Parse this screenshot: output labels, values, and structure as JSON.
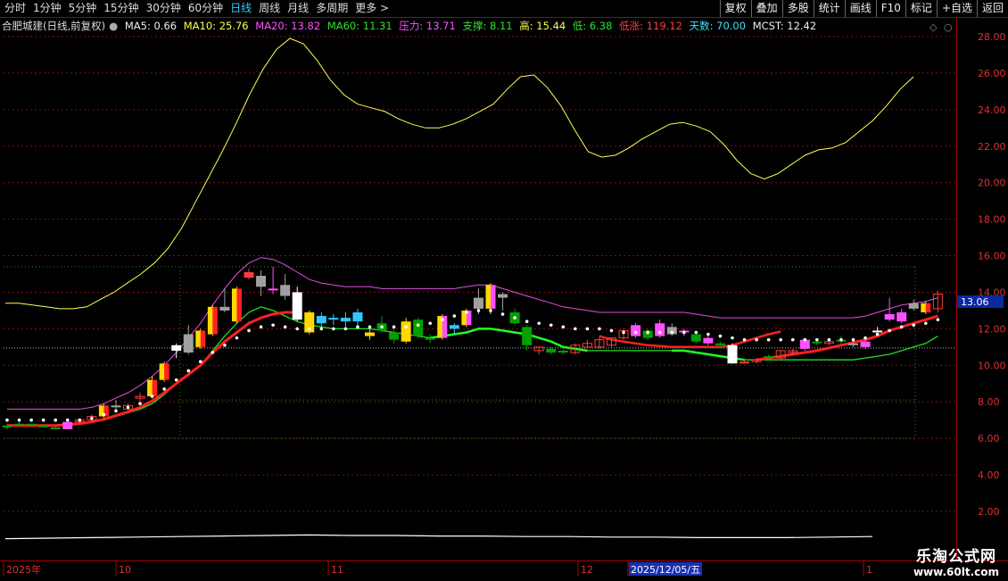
{
  "toolbar": {
    "periods": [
      "分时",
      "1分钟",
      "5分钟",
      "15分钟",
      "30分钟",
      "60分钟",
      "日线",
      "周线",
      "月线",
      "多周期",
      "更多 >"
    ],
    "active_period": "日线",
    "right_buttons": [
      "复权",
      "叠加",
      "多股",
      "统计",
      "画线",
      "F10",
      "标记",
      "+自选",
      "返回"
    ]
  },
  "info": {
    "stock": "合肥城建(日线,前复权)",
    "ma5": "MA5: 0.66",
    "ma10": "MA10: 25.76",
    "ma20": "MA20: 13.82",
    "ma60": "MA60: 11.31",
    "pressure": "压力: 13.71",
    "support": "支撑: 8.11",
    "high": "高: 15.44",
    "low": "低: 6.38",
    "lowrise": "低涨: 119.12",
    "days": "天数: 70.00",
    "mcst": "MCST: 12.42"
  },
  "colors": {
    "up": "#ff3c3c",
    "down": "#00a000",
    "yellow": "#ffff50",
    "magenta": "#ff50ff",
    "green": "#30e030",
    "cyan": "#40e0ff",
    "white": "#ffffff",
    "grid": "#801010"
  },
  "price_tag": "13.06",
  "dates": {
    "year": "2025年",
    "oct": "10",
    "nov": "11",
    "dec": "12",
    "cursor": "2025/12/05/五",
    "jan": "1"
  },
  "watermark": {
    "line1": "乐淘公式网",
    "line2": "www.60lt.com"
  },
  "chart_data": {
    "type": "candlestick",
    "ylim": [
      0.0,
      29.0
    ],
    "y_ticks": [
      2.0,
      4.0,
      6.0,
      8.0,
      10.0,
      12.0,
      14.0,
      16.0,
      18.0,
      20.0,
      22.0,
      24.0,
      26.0,
      28.0
    ],
    "horizontal_levels": {
      "pressure": 15.4,
      "support": 8.1,
      "mcst": 10.95
    },
    "candles": [
      {
        "o": 6.6,
        "h": 6.8,
        "l": 6.5,
        "c": 6.7,
        "t": "g"
      },
      {
        "o": 6.8,
        "h": 6.9,
        "l": 6.7,
        "c": 6.7,
        "t": "g"
      },
      {
        "o": 6.7,
        "h": 6.8,
        "l": 6.6,
        "c": 6.8,
        "t": "g"
      },
      {
        "o": 6.7,
        "h": 6.8,
        "l": 6.6,
        "c": 6.7,
        "t": "g"
      },
      {
        "o": 6.6,
        "h": 6.7,
        "l": 6.5,
        "c": 6.5,
        "t": "g"
      },
      {
        "o": 6.5,
        "h": 6.9,
        "l": 6.5,
        "c": 6.9,
        "t": "m"
      },
      {
        "o": 6.9,
        "h": 7.1,
        "l": 6.8,
        "c": 7.0,
        "t": "r"
      },
      {
        "o": 7.0,
        "h": 7.3,
        "l": 6.9,
        "c": 7.2,
        "t": "r"
      },
      {
        "o": 7.2,
        "h": 7.9,
        "l": 7.1,
        "c": 7.8,
        "t": "yr"
      },
      {
        "o": 7.8,
        "h": 8.1,
        "l": 7.5,
        "c": 7.7,
        "t": "gr"
      },
      {
        "o": 7.6,
        "h": 7.9,
        "l": 7.5,
        "c": 7.8,
        "t": "r"
      },
      {
        "o": 8.2,
        "h": 8.5,
        "l": 8.0,
        "c": 8.3,
        "t": "r"
      },
      {
        "o": 8.3,
        "h": 9.4,
        "l": 8.2,
        "c": 9.2,
        "t": "yr"
      },
      {
        "o": 9.2,
        "h": 10.2,
        "l": 9.1,
        "c": 10.1,
        "t": "yr"
      },
      {
        "o": 10.8,
        "h": 11.2,
        "l": 10.4,
        "c": 11.1,
        "t": "w"
      },
      {
        "o": 10.7,
        "h": 12.2,
        "l": 10.6,
        "c": 11.7,
        "t": "gr"
      },
      {
        "o": 11.0,
        "h": 12.0,
        "l": 10.9,
        "c": 11.9,
        "t": "yr"
      },
      {
        "o": 11.7,
        "h": 13.3,
        "l": 11.6,
        "c": 13.2,
        "t": "yr"
      },
      {
        "o": 13.0,
        "h": 14.2,
        "l": 12.9,
        "c": 13.2,
        "t": "gr"
      },
      {
        "o": 12.4,
        "h": 14.3,
        "l": 12.3,
        "c": 14.2,
        "t": "yr"
      },
      {
        "o": 15.1,
        "h": 15.3,
        "l": 14.7,
        "c": 14.8,
        "t": "r"
      },
      {
        "o": 14.9,
        "h": 15.2,
        "l": 13.8,
        "c": 14.3,
        "t": "gr"
      },
      {
        "o": 14.2,
        "h": 15.4,
        "l": 13.9,
        "c": 14.2,
        "t": "m"
      },
      {
        "o": 14.4,
        "h": 15.0,
        "l": 13.6,
        "c": 13.8,
        "t": "gr"
      },
      {
        "o": 14.0,
        "h": 14.3,
        "l": 12.4,
        "c": 12.5,
        "t": "w"
      },
      {
        "o": 12.9,
        "h": 13.0,
        "l": 11.7,
        "c": 11.8,
        "t": "y"
      },
      {
        "o": 12.7,
        "h": 12.9,
        "l": 12.1,
        "c": 12.3,
        "t": "c"
      },
      {
        "o": 12.6,
        "h": 12.8,
        "l": 12.2,
        "c": 12.5,
        "t": "c"
      },
      {
        "o": 12.6,
        "h": 12.9,
        "l": 12.1,
        "c": 12.4,
        "t": "c"
      },
      {
        "o": 12.4,
        "h": 13.1,
        "l": 12.2,
        "c": 12.9,
        "t": "c"
      },
      {
        "o": 11.8,
        "h": 12.0,
        "l": 11.4,
        "c": 11.6,
        "t": "y"
      },
      {
        "o": 12.3,
        "h": 12.7,
        "l": 11.8,
        "c": 11.9,
        "t": "g"
      },
      {
        "o": 11.8,
        "h": 12.0,
        "l": 11.2,
        "c": 11.4,
        "t": "g"
      },
      {
        "o": 12.4,
        "h": 12.6,
        "l": 11.2,
        "c": 11.3,
        "t": "y"
      },
      {
        "o": 12.5,
        "h": 12.6,
        "l": 11.5,
        "c": 11.6,
        "t": "g"
      },
      {
        "o": 11.5,
        "h": 11.7,
        "l": 11.2,
        "c": 11.4,
        "t": "g"
      },
      {
        "o": 11.5,
        "h": 12.8,
        "l": 11.4,
        "c": 12.7,
        "t": "ym"
      },
      {
        "o": 12.0,
        "h": 12.3,
        "l": 11.7,
        "c": 12.2,
        "t": "c"
      },
      {
        "o": 12.2,
        "h": 13.1,
        "l": 12.1,
        "c": 13.0,
        "t": "ym"
      },
      {
        "o": 13.1,
        "h": 14.2,
        "l": 12.8,
        "c": 13.7,
        "t": "gr"
      },
      {
        "o": 13.1,
        "h": 14.5,
        "l": 12.8,
        "c": 14.4,
        "t": "ym"
      },
      {
        "o": 13.9,
        "h": 14.0,
        "l": 13.0,
        "c": 13.7,
        "t": "gr"
      },
      {
        "o": 12.9,
        "h": 13.1,
        "l": 12.2,
        "c": 12.3,
        "t": "g"
      },
      {
        "o": 12.1,
        "h": 12.2,
        "l": 10.8,
        "c": 11.1,
        "t": "g"
      },
      {
        "o": 10.8,
        "h": 11.0,
        "l": 10.6,
        "c": 11.0,
        "t": "r"
      },
      {
        "o": 10.9,
        "h": 11.0,
        "l": 10.6,
        "c": 10.7,
        "t": "g"
      },
      {
        "o": 10.8,
        "h": 10.9,
        "l": 10.6,
        "c": 10.7,
        "t": "g"
      },
      {
        "o": 10.7,
        "h": 11.2,
        "l": 10.6,
        "c": 11.1,
        "t": "r"
      },
      {
        "o": 11.0,
        "h": 11.4,
        "l": 10.9,
        "c": 11.2,
        "t": "r"
      },
      {
        "o": 11.0,
        "h": 11.6,
        "l": 10.9,
        "c": 11.4,
        "t": "r"
      },
      {
        "o": 11.1,
        "h": 11.5,
        "l": 11.0,
        "c": 11.5,
        "t": "r"
      },
      {
        "o": 11.5,
        "h": 12.0,
        "l": 11.4,
        "c": 11.9,
        "t": "r"
      },
      {
        "o": 11.6,
        "h": 12.3,
        "l": 11.5,
        "c": 12.2,
        "t": "m"
      },
      {
        "o": 11.9,
        "h": 12.0,
        "l": 11.4,
        "c": 11.5,
        "t": "g"
      },
      {
        "o": 11.6,
        "h": 12.5,
        "l": 11.5,
        "c": 12.3,
        "t": "m"
      },
      {
        "o": 12.1,
        "h": 12.3,
        "l": 11.6,
        "c": 11.7,
        "t": "gr"
      },
      {
        "o": 11.8,
        "h": 12.0,
        "l": 11.6,
        "c": 11.9,
        "t": "m"
      },
      {
        "o": 11.7,
        "h": 11.8,
        "l": 11.2,
        "c": 11.3,
        "t": "g"
      },
      {
        "o": 11.2,
        "h": 11.6,
        "l": 11.1,
        "c": 11.5,
        "t": "m"
      },
      {
        "o": 11.2,
        "h": 11.3,
        "l": 11.0,
        "c": 11.1,
        "t": "g"
      },
      {
        "o": 11.1,
        "h": 11.2,
        "l": 10.1,
        "c": 10.1,
        "t": "w"
      },
      {
        "o": 10.2,
        "h": 10.3,
        "l": 10.1,
        "c": 10.2,
        "t": "r"
      },
      {
        "o": 10.2,
        "h": 10.4,
        "l": 10.1,
        "c": 10.3,
        "t": "r"
      },
      {
        "o": 10.4,
        "h": 10.6,
        "l": 10.3,
        "c": 10.5,
        "t": "g"
      },
      {
        "o": 10.4,
        "h": 10.8,
        "l": 10.3,
        "c": 10.8,
        "t": "r"
      },
      {
        "o": 10.7,
        "h": 10.9,
        "l": 10.6,
        "c": 10.8,
        "t": "r"
      },
      {
        "o": 10.9,
        "h": 11.5,
        "l": 10.8,
        "c": 11.4,
        "t": "m"
      },
      {
        "o": 11.3,
        "h": 11.4,
        "l": 11.1,
        "c": 11.2,
        "t": "g"
      },
      {
        "o": 11.2,
        "h": 11.4,
        "l": 11.1,
        "c": 11.3,
        "t": "r"
      },
      {
        "o": 11.4,
        "h": 11.6,
        "l": 11.2,
        "c": 11.3,
        "t": "g"
      },
      {
        "o": 11.2,
        "h": 11.4,
        "l": 11.0,
        "c": 11.1,
        "t": "gr"
      },
      {
        "o": 11.0,
        "h": 11.4,
        "l": 10.9,
        "c": 11.3,
        "t": "m"
      },
      {
        "o": 11.9,
        "h": 12.1,
        "l": 11.8,
        "c": 11.9,
        "t": "w"
      },
      {
        "o": 12.5,
        "h": 13.7,
        "l": 12.4,
        "c": 12.8,
        "t": "m"
      },
      {
        "o": 12.4,
        "h": 13.1,
        "l": 12.3,
        "c": 12.9,
        "t": "m"
      },
      {
        "o": 13.1,
        "h": 13.6,
        "l": 13.0,
        "c": 13.4,
        "t": "gr"
      },
      {
        "o": 12.9,
        "h": 13.5,
        "l": 12.8,
        "c": 13.4,
        "t": "yr"
      },
      {
        "o": 13.1,
        "h": 14.1,
        "l": 12.9,
        "c": 13.9,
        "t": "r"
      }
    ],
    "ma_red": [
      6.7,
      6.7,
      6.7,
      6.7,
      6.7,
      6.75,
      6.8,
      6.9,
      7.05,
      7.25,
      7.45,
      7.7,
      8.05,
      8.5,
      9.0,
      9.5,
      10.0,
      10.7,
      11.3,
      11.8,
      12.3,
      12.6,
      12.8,
      12.9,
      12.9
    ],
    "ma_red_start": 0,
    "ma_red2": [
      11.6,
      11.4,
      11.3,
      11.2,
      11.1,
      11.05,
      11.0,
      11.0,
      11.0,
      11.0,
      11.0,
      11.1,
      11.3,
      11.5,
      11.7,
      11.85
    ],
    "ma_red2_start": 49,
    "ma_red3": [
      10.3,
      10.4,
      10.5,
      10.6,
      10.7,
      10.8,
      10.95,
      11.1,
      11.25,
      11.4,
      11.6,
      11.9,
      12.1,
      12.3,
      12.5,
      12.7
    ],
    "ma_red3_start": 62,
    "ma_white_dots": [
      7.0,
      7.0,
      7.0,
      7.0,
      7.0,
      7.0,
      7.0,
      7.1,
      7.3,
      7.5,
      7.7,
      7.9,
      8.3,
      8.7,
      9.2,
      9.7,
      10.2,
      10.7,
      11.1,
      11.5,
      11.9,
      12.1,
      12.2,
      12.1,
      12.0,
      12.0,
      12.0,
      12.0,
      12.0,
      12.1,
      12.1,
      12.1,
      12.1,
      12.1,
      12.2,
      12.3,
      12.5,
      12.7,
      12.9,
      13.0,
      13.0,
      12.8,
      12.6,
      12.4,
      12.3,
      12.2,
      12.1,
      12.0,
      12.0,
      12.0,
      11.9,
      11.8,
      11.8,
      11.8,
      11.8,
      11.8,
      11.8,
      11.8,
      11.7,
      11.6,
      11.5,
      11.4,
      11.4,
      11.4,
      11.4,
      11.4,
      11.4,
      11.4,
      11.4,
      11.4,
      11.4,
      11.5,
      11.7,
      11.9,
      12.1,
      12.2,
      12.3,
      12.5
    ],
    "ma_green": [
      6.7,
      6.7,
      6.7,
      6.7,
      6.7,
      6.7,
      6.8,
      6.9,
      7.0,
      7.2,
      7.4,
      7.6,
      7.9,
      8.4,
      9.0,
      9.5,
      10.0,
      10.8,
      11.6,
      12.3,
      12.9,
      13.2,
      13.0,
      12.7,
      12.4,
      12.2,
      12.1,
      12.0,
      12.0,
      12.0,
      12.0,
      11.9,
      11.8,
      11.7,
      11.6,
      11.5,
      11.6,
      11.7,
      11.8,
      12.0,
      12.0,
      11.9,
      11.8,
      11.7,
      11.5,
      11.3,
      11.0,
      10.9,
      10.8,
      10.8,
      10.8,
      10.8,
      10.8,
      10.8,
      10.8,
      10.8,
      10.8,
      10.7,
      10.6,
      10.5,
      10.4,
      10.3,
      10.3,
      10.3,
      10.3,
      10.3,
      10.3,
      10.3,
      10.3,
      10.3,
      10.3,
      10.4,
      10.5,
      10.6,
      10.8,
      11.0,
      11.2,
      11.6
    ],
    "ma_magenta": [
      7.6,
      7.6,
      7.6,
      7.6,
      7.6,
      7.6,
      7.6,
      7.7,
      7.9,
      8.2,
      8.5,
      8.9,
      9.4,
      10.0,
      10.7,
      11.5,
      12.3,
      13.3,
      14.2,
      15.0,
      15.6,
      15.9,
      15.8,
      15.5,
      15.1,
      14.7,
      14.5,
      14.4,
      14.3,
      14.3,
      14.3,
      14.2,
      14.2,
      14.2,
      14.2,
      14.2,
      14.2,
      14.2,
      14.3,
      14.4,
      14.4,
      14.2,
      14.0,
      13.8,
      13.6,
      13.4,
      13.2,
      13.1,
      13.0,
      12.9,
      12.9,
      12.9,
      12.9,
      12.9,
      12.9,
      12.9,
      12.9,
      12.8,
      12.7,
      12.6,
      12.6,
      12.6,
      12.6,
      12.6,
      12.6,
      12.6,
      12.6,
      12.6,
      12.6,
      12.6,
      12.6,
      12.7,
      12.9,
      13.1,
      13.3,
      13.4,
      13.5,
      13.7
    ],
    "ma_yellow": [
      13.4,
      13.4,
      13.3,
      13.2,
      13.1,
      13.1,
      13.2,
      13.6,
      14.0,
      14.5,
      15.0,
      15.6,
      16.4,
      17.5,
      18.9,
      20.3,
      21.7,
      23.2,
      24.8,
      26.2,
      27.3,
      27.9,
      27.6,
      26.7,
      25.6,
      24.8,
      24.3,
      24.1,
      23.9,
      23.5,
      23.2,
      23.0,
      23.0,
      23.2,
      23.5,
      23.9,
      24.3,
      25.1,
      25.8,
      25.9,
      25.2,
      24.2,
      22.9,
      21.7,
      21.4,
      21.5,
      21.9,
      22.4,
      22.8,
      23.2,
      23.3,
      23.1,
      22.8,
      22.1,
      21.2,
      20.5,
      20.2,
      20.5,
      21.0,
      21.5,
      21.8,
      21.9,
      22.2,
      22.8,
      23.4,
      24.2,
      25.1,
      25.8
    ],
    "ma_yellow_step": 1.15,
    "ma_bottom_white": [
      0.2,
      0.25,
      0.3,
      0.35,
      0.4,
      0.45,
      0.5,
      0.55,
      0.5,
      0.5,
      0.45,
      0.45,
      0.4,
      0.4,
      0.35,
      0.35,
      0.3,
      0.3,
      0.3,
      0.35,
      0.4
    ]
  }
}
